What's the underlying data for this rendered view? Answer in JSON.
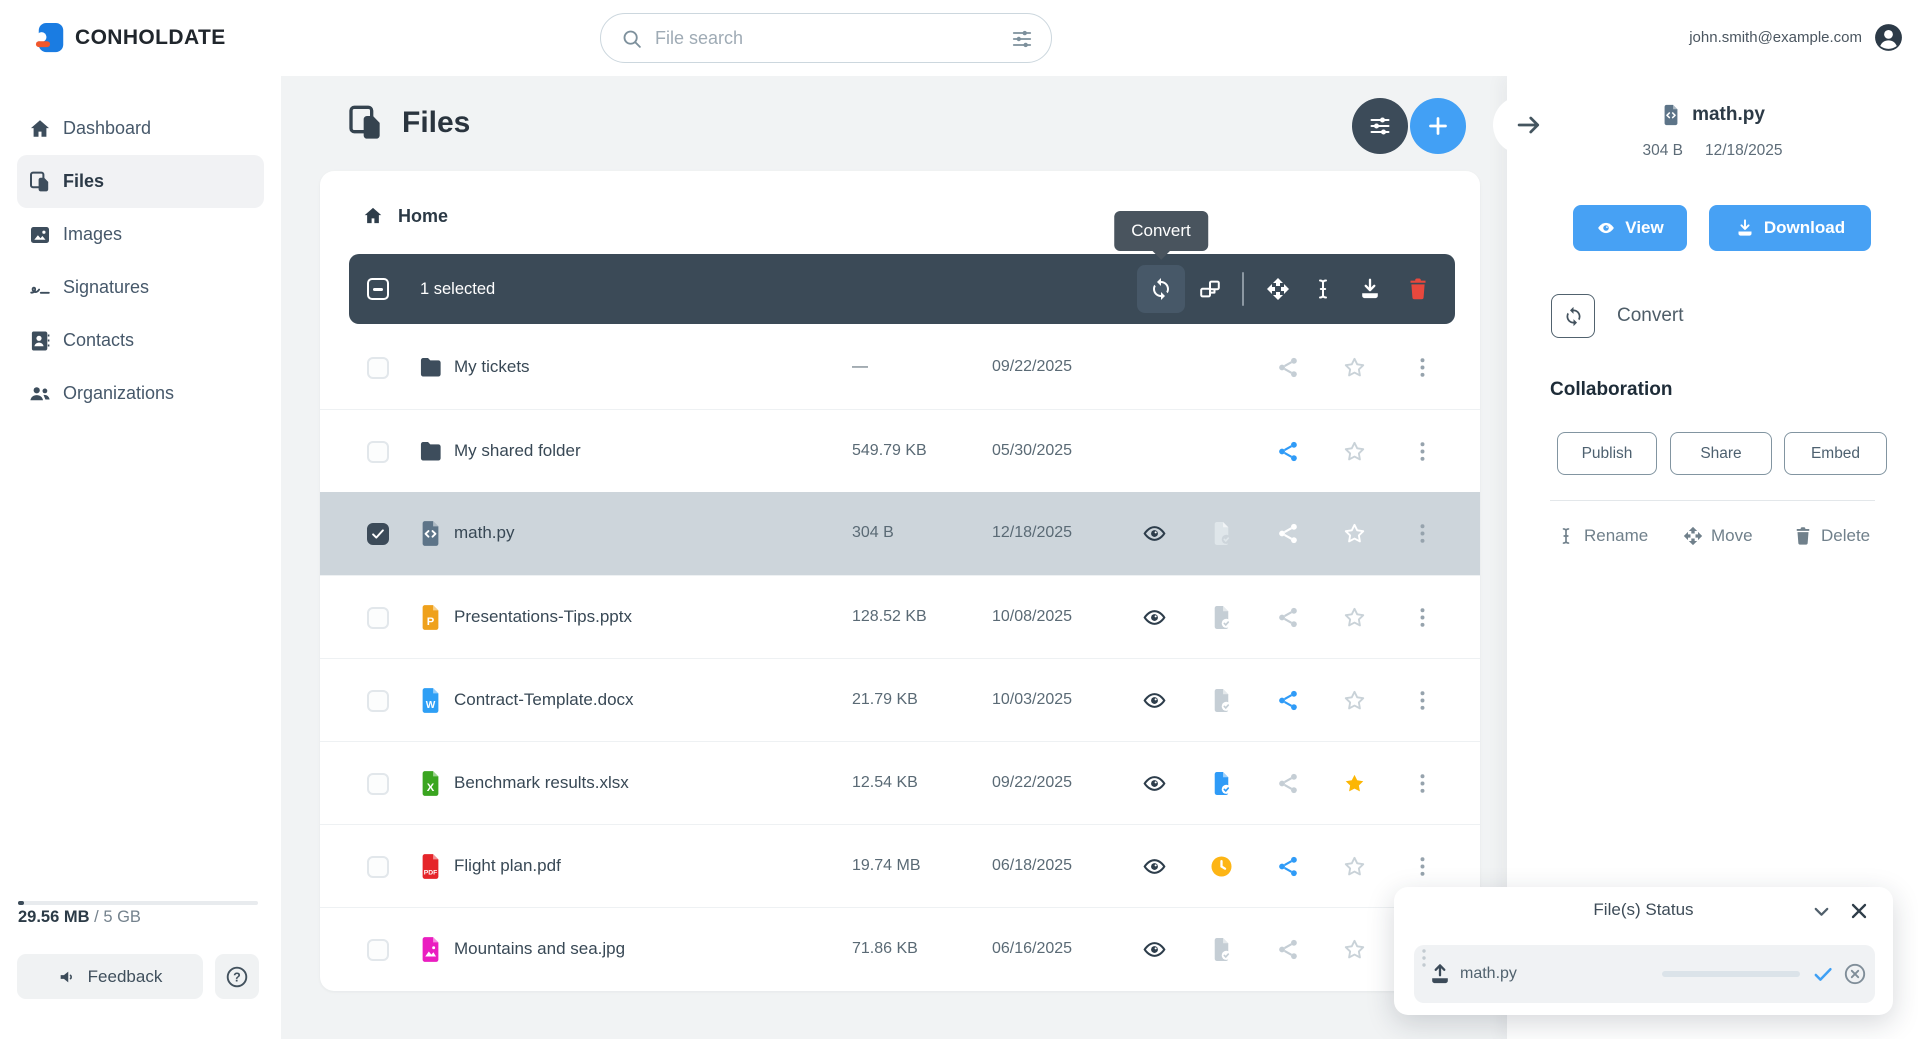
{
  "topbar": {
    "brand": "CONHOLDATE",
    "search_placeholder": "File search",
    "user_email": "john.smith@example.com"
  },
  "sidebar": {
    "items": [
      {
        "label": "Dashboard",
        "icon": "home",
        "active": false
      },
      {
        "label": "Files",
        "icon": "files",
        "active": true
      },
      {
        "label": "Images",
        "icon": "image",
        "active": false
      },
      {
        "label": "Signatures",
        "icon": "signature",
        "active": false
      },
      {
        "label": "Contacts",
        "icon": "contacts",
        "active": false
      },
      {
        "label": "Organizations",
        "icon": "organizations",
        "active": false
      }
    ],
    "storage": {
      "used": "29.56 MB",
      "separator": "/",
      "total": "5 GB",
      "percent_used": 0.6
    },
    "feedback_label": "Feedback"
  },
  "main": {
    "title": "Files",
    "breadcrumb": "Home",
    "selection_toolbar": {
      "selected_text": "1 selected",
      "tooltip": "Convert"
    },
    "rows": [
      {
        "name": "My tickets",
        "type": "folder",
        "size": "—",
        "date": "09/22/2025",
        "checked": false,
        "selected": false,
        "actions": {
          "eye": false,
          "doc": "none",
          "share": "gray",
          "star": "outline"
        }
      },
      {
        "name": "My shared folder",
        "type": "folder",
        "size": "549.79 KB",
        "date": "05/30/2025",
        "checked": false,
        "selected": false,
        "actions": {
          "eye": false,
          "doc": "none",
          "share": "blue",
          "star": "outline"
        }
      },
      {
        "name": "math.py",
        "type": "py",
        "size": "304 B",
        "date": "12/18/2025",
        "checked": true,
        "selected": true,
        "actions": {
          "eye": true,
          "doc": "check-light",
          "share": "light",
          "star": "light"
        }
      },
      {
        "name": "Presentations-Tips.pptx",
        "type": "pptx",
        "size": "128.52 KB",
        "date": "10/08/2025",
        "checked": false,
        "selected": false,
        "actions": {
          "eye": true,
          "doc": "check-gray",
          "share": "gray",
          "star": "outline"
        }
      },
      {
        "name": "Contract-Template.docx",
        "type": "docx",
        "size": "21.79 KB",
        "date": "10/03/2025",
        "checked": false,
        "selected": false,
        "actions": {
          "eye": true,
          "doc": "check-gray",
          "share": "blue",
          "star": "outline"
        }
      },
      {
        "name": "Benchmark results.xlsx",
        "type": "xlsx",
        "size": "12.54 KB",
        "date": "09/22/2025",
        "checked": false,
        "selected": false,
        "actions": {
          "eye": true,
          "doc": "check-blue",
          "share": "gray",
          "star": "yellow"
        }
      },
      {
        "name": "Flight plan.pdf",
        "type": "pdf",
        "size": "19.74 MB",
        "date": "06/18/2025",
        "checked": false,
        "selected": false,
        "actions": {
          "eye": true,
          "doc": "clock",
          "share": "blue",
          "star": "outline"
        }
      },
      {
        "name": "Mountains and sea.jpg",
        "type": "jpg",
        "size": "71.86 KB",
        "date": "06/16/2025",
        "checked": false,
        "selected": false,
        "actions": {
          "eye": true,
          "doc": "check-gray",
          "share": "gray",
          "star": "outline"
        }
      }
    ]
  },
  "details_panel": {
    "file_name": "math.py",
    "file_size": "304 B",
    "file_date": "12/18/2025",
    "view_label": "View",
    "download_label": "Download",
    "convert_label": "Convert",
    "collaboration_title": "Collaboration",
    "publish_label": "Publish",
    "share_label": "Share",
    "embed_label": "Embed",
    "rename_label": "Rename",
    "move_label": "Move",
    "delete_label": "Delete"
  },
  "status_panel": {
    "title": "File(s) Status",
    "item_name": "math.py",
    "progress_percent": 100
  },
  "colors": {
    "accent_blue": "#47a1f4",
    "slate": "#3c4b59",
    "share_blue": "#2f9bf7",
    "star_yellow": "#fcb603",
    "danger_red": "#e8483d",
    "clock_yellow": "#fdb515",
    "folder": "#3d4d5c",
    "py": "#5d7488",
    "pptx": "#efa11b",
    "docx": "#2e9ff5",
    "xlsx": "#3aa520",
    "pdf": "#e5252a",
    "jpg": "#ea1ec0",
    "selected_row_bg": "#cdd5db"
  }
}
